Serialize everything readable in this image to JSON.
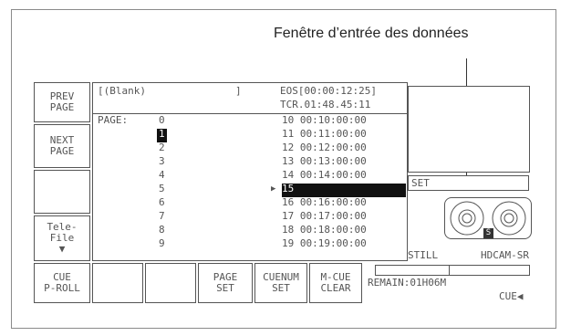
{
  "annotation": {
    "callout_label": "Fenêtre d’entrée des données"
  },
  "left_buttons": {
    "prev_page": [
      "PREV",
      "PAGE"
    ],
    "next_page": [
      "NEXT",
      "PAGE"
    ],
    "telefile": [
      "Tele-",
      "File",
      "▼"
    ],
    "cue_preroll": [
      "CUE",
      "P-ROLL"
    ]
  },
  "header": {
    "title": "[(Blank)",
    "bracket_close": "]",
    "eos": "EOS[00:00:12:25]",
    "tcr": "TCR.01:48.45:11"
  },
  "page_list": {
    "label": "PAGE:",
    "pages": [
      "0",
      "1",
      "2",
      "3",
      "4",
      "5",
      "6",
      "7",
      "8",
      "9"
    ],
    "selected": "1"
  },
  "cue_list": {
    "entries": [
      {
        "num": "10",
        "tc": "00:10:00:00"
      },
      {
        "num": "11",
        "tc": "00:11:00:00"
      },
      {
        "num": "12",
        "tc": "00:12:00:00"
      },
      {
        "num": "13",
        "tc": "00:13:00:00"
      },
      {
        "num": "14",
        "tc": "00:14:00:00"
      },
      {
        "num": "15",
        "tc": ""
      },
      {
        "num": "16",
        "tc": "00:16:00:00"
      },
      {
        "num": "17",
        "tc": "00:17:00:00"
      },
      {
        "num": "18",
        "tc": "00:18:00:00"
      },
      {
        "num": "19",
        "tc": "00:19:00:00"
      }
    ],
    "cursor": "▶",
    "selected_num": "15"
  },
  "right_panel": {
    "set_label": "SET",
    "tape_badge": "S",
    "status_still": "STILL",
    "model": "HDCAM-SR",
    "remain": "REMAIN:01H06M",
    "cue_indicator": "CUE◀"
  },
  "bottom_buttons": {
    "page_set": [
      "PAGE",
      "SET"
    ],
    "cuenum_set": [
      "CUENUM",
      "SET"
    ],
    "mcue_clear": [
      "M-CUE",
      "CLEAR"
    ]
  }
}
